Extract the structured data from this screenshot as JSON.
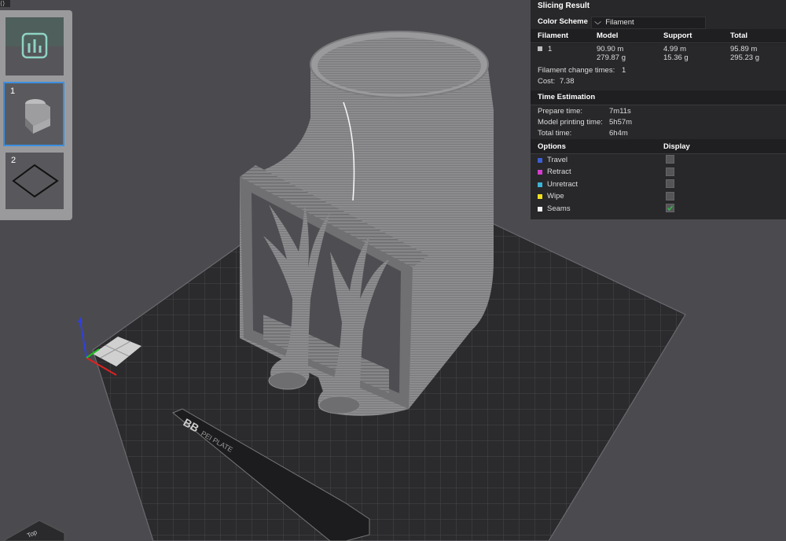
{
  "panel": {
    "title": "Slicing Result",
    "color_scheme_label": "Color Scheme",
    "color_scheme_value": "Filament",
    "filament_table": {
      "headers": [
        "Filament",
        "Model",
        "Support",
        "Total"
      ],
      "row": {
        "id": "1",
        "model_length": "90.90 m",
        "model_weight": "279.87 g",
        "support_length": "4.99 m",
        "support_weight": "15.36 g",
        "total_length": "95.89 m",
        "total_weight": "295.23 g"
      }
    },
    "filament_change_label": "Filament change times:",
    "filament_change_value": "1",
    "cost_label": "Cost:",
    "cost_value": "7.38",
    "time_title": "Time Estimation",
    "prepare_label": "Prepare time:",
    "prepare_value": "7m11s",
    "model_print_label": "Model printing time:",
    "model_print_value": "5h57m",
    "total_time_label": "Total time:",
    "total_time_value": "6h4m",
    "options_title": "Options",
    "display_title": "Display",
    "options": [
      {
        "label": "Travel",
        "color": "#3c5fd6",
        "checked": false
      },
      {
        "label": "Retract",
        "color": "#d63ccf",
        "checked": false
      },
      {
        "label": "Unretract",
        "color": "#3cb4d6",
        "checked": false
      },
      {
        "label": "Wipe",
        "color": "#f0e020",
        "checked": false
      },
      {
        "label": "Seams",
        "color": "#f2f2f2",
        "checked": true
      }
    ]
  },
  "thumbnails": {
    "items": [
      {
        "number": "",
        "icon": "slice-summary-icon"
      },
      {
        "number": "1",
        "icon": "object-preview-icon"
      },
      {
        "number": "2",
        "icon": "plate-outline-icon"
      }
    ]
  },
  "bed": {
    "plate_label": "PEI PLATE",
    "brand_glyph": "BB",
    "view_cube_label": "Top",
    "top_corner_glyph": "⟨⟩"
  },
  "colors": {
    "panel_bg": "#28282b",
    "accent_selected": "#3b8fe0",
    "axis_x": "#e02020",
    "axis_y": "#20c020",
    "axis_z": "#3040e0"
  }
}
